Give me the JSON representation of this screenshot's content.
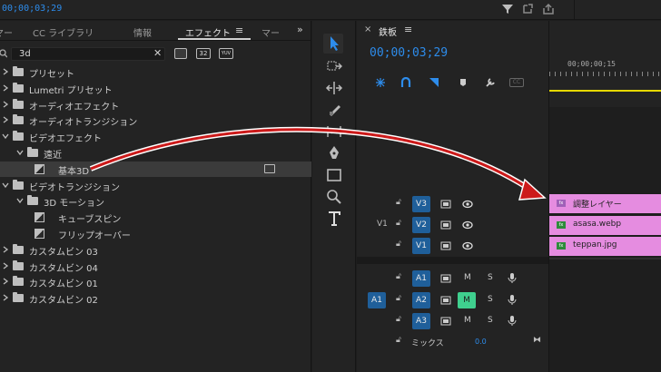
{
  "top_bar": {
    "timecode": "00;00;03;29"
  },
  "effects_panel": {
    "tabs": [
      {
        "label": "マー"
      },
      {
        "label": "CC ライブラリ"
      },
      {
        "label": "情報"
      },
      {
        "label": "エフェクト",
        "active": true
      },
      {
        "label": "マー"
      }
    ],
    "search_value": "3d",
    "tree": [
      {
        "label": "プリセット",
        "type": "folder"
      },
      {
        "label": "Lumetri プリセット",
        "type": "folder"
      },
      {
        "label": "オーディオエフェクト",
        "type": "folder"
      },
      {
        "label": "オーディオトランジション",
        "type": "folder"
      },
      {
        "label": "ビデオエフェクト",
        "type": "folder"
      },
      {
        "label": "遠近",
        "type": "folder"
      },
      {
        "label": "基本3D",
        "type": "effect",
        "selected": true
      },
      {
        "label": "ビデオトランジション",
        "type": "folder"
      },
      {
        "label": "3D モーション",
        "type": "folder"
      },
      {
        "label": "キューブスピン",
        "type": "effect"
      },
      {
        "label": "フリップオーバー",
        "type": "effect"
      },
      {
        "label": "カスタムビン 03",
        "type": "folder"
      },
      {
        "label": "カスタムビン 04",
        "type": "folder"
      },
      {
        "label": "カスタムビン 01",
        "type": "folder"
      },
      {
        "label": "カスタムビン 02",
        "type": "folder"
      }
    ]
  },
  "timeline": {
    "sequence_name": "鉄板",
    "timecode": "00;00;03;29",
    "ruler_label": "00;00;00;15",
    "tracks": {
      "v3": "V3",
      "v2": "V2",
      "v1": "V1",
      "v1_source": "V1",
      "a1": "A1",
      "a2": "A2",
      "a3": "A3",
      "a1_source": "A1",
      "mute": "M",
      "solo": "S",
      "mix_label": "ミックス",
      "mix_value": "0.0"
    },
    "clips": [
      {
        "label": "調整レイヤー"
      },
      {
        "label": "asasa.webp"
      },
      {
        "label": "teppan.jpg"
      }
    ]
  },
  "colors": {
    "accent_blue": "#2d8ceb",
    "clip_pink": "#e58ce0",
    "arrow_red": "#cc1a1a"
  }
}
